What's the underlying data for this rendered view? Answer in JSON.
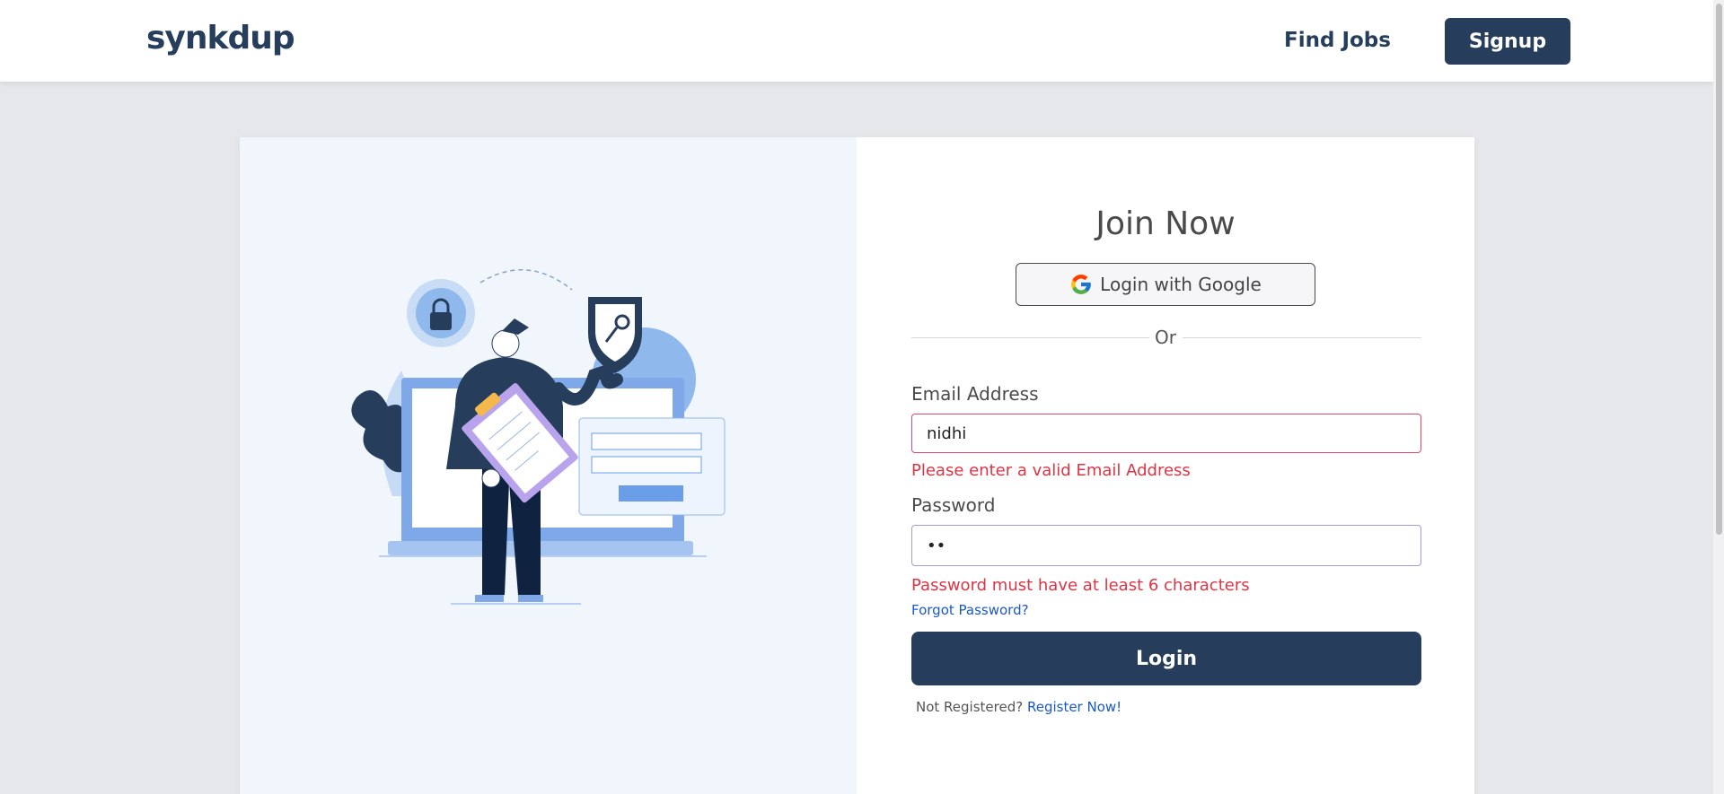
{
  "header": {
    "logo": "synkdup",
    "find_jobs": "Find Jobs",
    "signup": "Signup"
  },
  "form": {
    "title": "Join Now",
    "google_button": "Login with Google",
    "or": "Or",
    "email_label": "Email Address",
    "email_value": "nidhi",
    "email_error": "Please enter a valid Email Address",
    "password_label": "Password",
    "password_value": "••",
    "password_error": "Password must have at least 6 characters",
    "forgot": "Forgot Password?",
    "login": "Login",
    "not_registered": "Not Registered?",
    "register_now": "Register Now!"
  },
  "colors": {
    "brand": "#263e5c",
    "error": "#dc3545",
    "link": "#1a58c4"
  }
}
